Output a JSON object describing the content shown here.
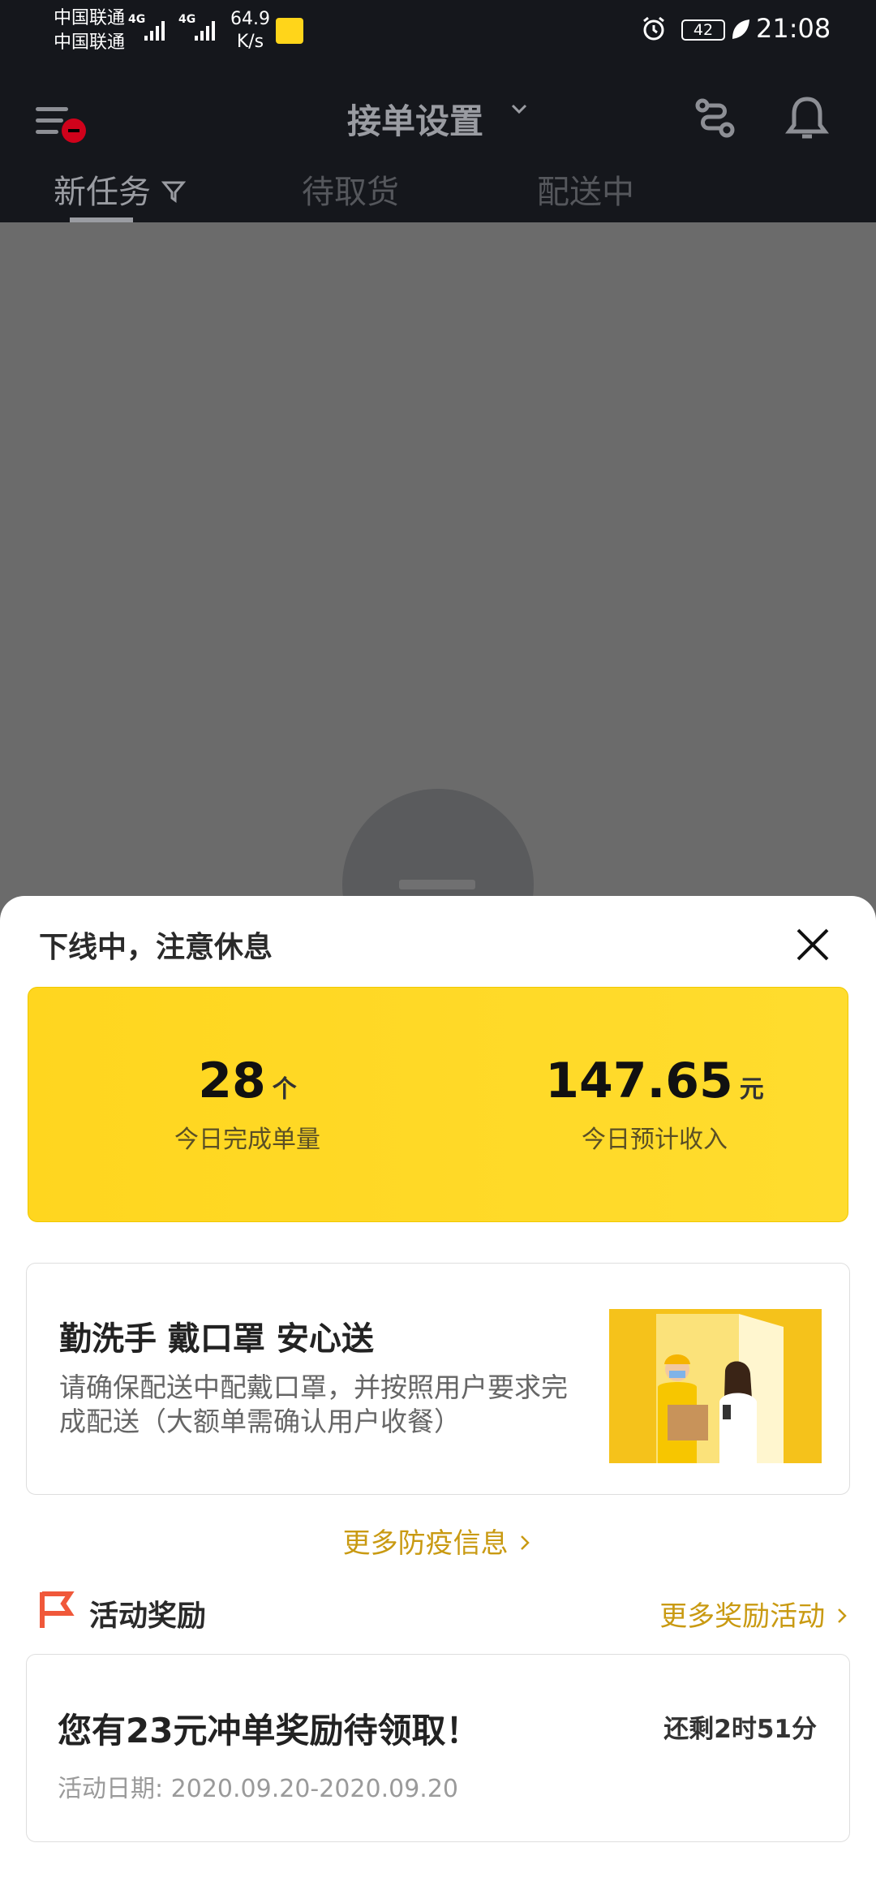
{
  "status_bar": {
    "carrier_1": "中国联通",
    "carrier_2": "中国联通",
    "net_1": "4G",
    "net_2": "4G",
    "speed_value": "64.9",
    "speed_unit": "K/s",
    "battery": "42",
    "time": "21:08"
  },
  "header": {
    "title": "接单设置"
  },
  "tabs": [
    {
      "label": "新任务"
    },
    {
      "label": "待取货"
    },
    {
      "label": "配送中"
    }
  ],
  "sheet": {
    "title": "下线中，注意休息",
    "stats": {
      "orders_value": "28",
      "orders_unit": "个",
      "orders_label": "今日完成单量",
      "income_value": "147.65",
      "income_unit": "元",
      "income_label": "今日预计收入"
    },
    "notice": {
      "title": "勤洗手 戴口罩 安心送",
      "body": "请确保配送中配戴口罩，并按照用户要求完成配送（大额单需确认用户收餐）"
    },
    "more_epidemic": "更多防疫信息",
    "rewards": {
      "section_title": "活动奖励",
      "more_link": "更多奖励活动",
      "card_title": "您有23元冲单奖励待领取！",
      "remaining": "还剩2时51分",
      "date": "活动日期: 2020.09.20-2020.09.20"
    }
  },
  "colors": {
    "accent_yellow": "#ffd61f",
    "link_gold": "#c99a12",
    "flag_red": "#f0583a"
  }
}
